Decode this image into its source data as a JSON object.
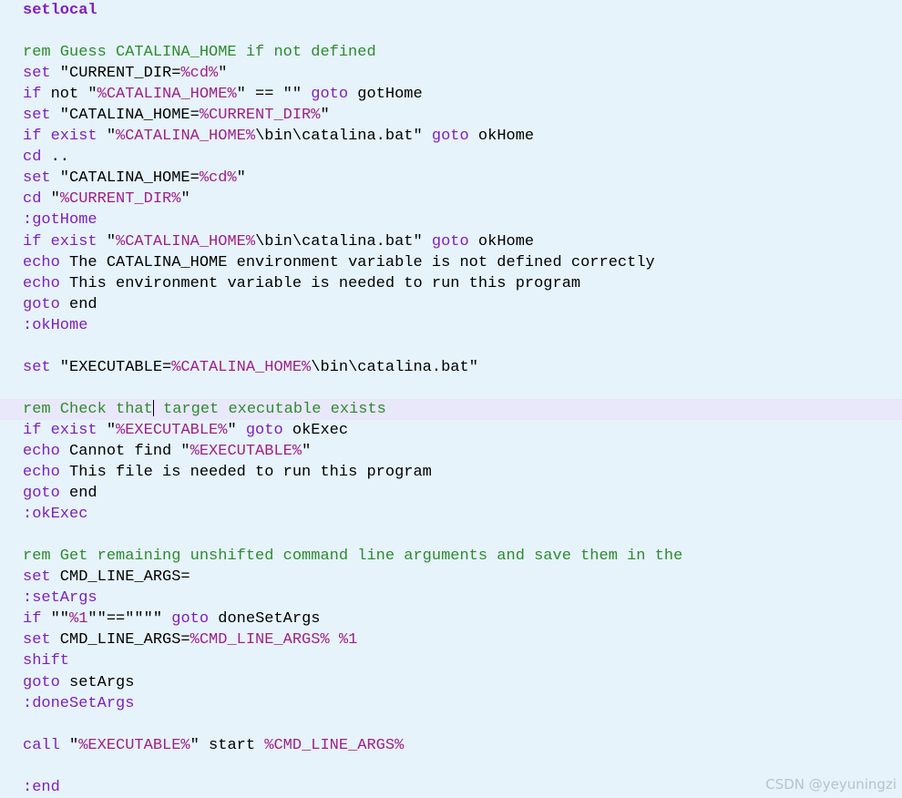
{
  "watermark": "CSDN @yeyuningzi",
  "cursor_line": 19,
  "colors": {
    "background": "#e6f3fa",
    "current_line": "#e8e8fa",
    "keyword": "#7f1fbf",
    "comment": "#2f8a2f",
    "variable": "#a0208a",
    "text": "#000000"
  },
  "code_lines": [
    [
      {
        "t": "bold",
        "s": "setlocal"
      }
    ],
    [],
    [
      {
        "t": "cmt",
        "s": "rem Guess CATALINA_HOME if not defined"
      }
    ],
    [
      {
        "t": "kw",
        "s": "set"
      },
      {
        "t": "txt",
        "s": " \"CURRENT_DIR="
      },
      {
        "t": "var",
        "s": "%cd%"
      },
      {
        "t": "txt",
        "s": "\""
      }
    ],
    [
      {
        "t": "kw",
        "s": "if"
      },
      {
        "t": "txt",
        "s": " not \""
      },
      {
        "t": "var",
        "s": "%CATALINA_HOME%"
      },
      {
        "t": "txt",
        "s": "\" == \"\" "
      },
      {
        "t": "kw",
        "s": "goto"
      },
      {
        "t": "txt",
        "s": " gotHome"
      }
    ],
    [
      {
        "t": "kw",
        "s": "set"
      },
      {
        "t": "txt",
        "s": " \"CATALINA_HOME="
      },
      {
        "t": "var",
        "s": "%CURRENT_DIR%"
      },
      {
        "t": "txt",
        "s": "\""
      }
    ],
    [
      {
        "t": "kw",
        "s": "if"
      },
      {
        "t": "txt",
        "s": " "
      },
      {
        "t": "kw",
        "s": "exist"
      },
      {
        "t": "txt",
        "s": " \""
      },
      {
        "t": "var",
        "s": "%CATALINA_HOME%"
      },
      {
        "t": "txt",
        "s": "\\bin\\catalina.bat\" "
      },
      {
        "t": "kw",
        "s": "goto"
      },
      {
        "t": "txt",
        "s": " okHome"
      }
    ],
    [
      {
        "t": "kw",
        "s": "cd"
      },
      {
        "t": "txt",
        "s": " .."
      }
    ],
    [
      {
        "t": "kw",
        "s": "set"
      },
      {
        "t": "txt",
        "s": " \"CATALINA_HOME="
      },
      {
        "t": "var",
        "s": "%cd%"
      },
      {
        "t": "txt",
        "s": "\""
      }
    ],
    [
      {
        "t": "kw",
        "s": "cd"
      },
      {
        "t": "txt",
        "s": " \""
      },
      {
        "t": "var",
        "s": "%CURRENT_DIR%"
      },
      {
        "t": "txt",
        "s": "\""
      }
    ],
    [
      {
        "t": "lbl",
        "s": ":gotHome"
      }
    ],
    [
      {
        "t": "kw",
        "s": "if"
      },
      {
        "t": "txt",
        "s": " "
      },
      {
        "t": "kw",
        "s": "exist"
      },
      {
        "t": "txt",
        "s": " \""
      },
      {
        "t": "var",
        "s": "%CATALINA_HOME%"
      },
      {
        "t": "txt",
        "s": "\\bin\\catalina.bat\" "
      },
      {
        "t": "kw",
        "s": "goto"
      },
      {
        "t": "txt",
        "s": " okHome"
      }
    ],
    [
      {
        "t": "kw",
        "s": "echo"
      },
      {
        "t": "txt",
        "s": " The CATALINA_HOME environment variable is not defined correctly"
      }
    ],
    [
      {
        "t": "kw",
        "s": "echo"
      },
      {
        "t": "txt",
        "s": " This environment variable is needed to run this program"
      }
    ],
    [
      {
        "t": "kw",
        "s": "goto"
      },
      {
        "t": "txt",
        "s": " end"
      }
    ],
    [
      {
        "t": "lbl",
        "s": ":okHome"
      }
    ],
    [],
    [
      {
        "t": "kw",
        "s": "set"
      },
      {
        "t": "txt",
        "s": " \"EXECUTABLE="
      },
      {
        "t": "var",
        "s": "%CATALINA_HOME%"
      },
      {
        "t": "txt",
        "s": "\\bin\\catalina.bat\""
      }
    ],
    [],
    [
      {
        "t": "cmt",
        "s": "rem Check that"
      },
      {
        "t": "caret",
        "s": ""
      },
      {
        "t": "cmt",
        "s": " target executable exists"
      }
    ],
    [
      {
        "t": "kw",
        "s": "if"
      },
      {
        "t": "txt",
        "s": " "
      },
      {
        "t": "kw",
        "s": "exist"
      },
      {
        "t": "txt",
        "s": " \""
      },
      {
        "t": "var",
        "s": "%EXECUTABLE%"
      },
      {
        "t": "txt",
        "s": "\" "
      },
      {
        "t": "kw",
        "s": "goto"
      },
      {
        "t": "txt",
        "s": " okExec"
      }
    ],
    [
      {
        "t": "kw",
        "s": "echo"
      },
      {
        "t": "txt",
        "s": " Cannot find \""
      },
      {
        "t": "var",
        "s": "%EXECUTABLE%"
      },
      {
        "t": "txt",
        "s": "\""
      }
    ],
    [
      {
        "t": "kw",
        "s": "echo"
      },
      {
        "t": "txt",
        "s": " This file is needed to run this program"
      }
    ],
    [
      {
        "t": "kw",
        "s": "goto"
      },
      {
        "t": "txt",
        "s": " end"
      }
    ],
    [
      {
        "t": "lbl",
        "s": ":okExec"
      }
    ],
    [],
    [
      {
        "t": "cmt",
        "s": "rem Get remaining unshifted command line arguments and save them in the"
      }
    ],
    [
      {
        "t": "kw",
        "s": "set"
      },
      {
        "t": "txt",
        "s": " CMD_LINE_ARGS="
      }
    ],
    [
      {
        "t": "lbl",
        "s": ":setArgs"
      }
    ],
    [
      {
        "t": "kw",
        "s": "if"
      },
      {
        "t": "txt",
        "s": " \"\""
      },
      {
        "t": "var",
        "s": "%1"
      },
      {
        "t": "txt",
        "s": "\"\"==\"\"\"\" "
      },
      {
        "t": "kw",
        "s": "goto"
      },
      {
        "t": "txt",
        "s": " doneSetArgs"
      }
    ],
    [
      {
        "t": "kw",
        "s": "set"
      },
      {
        "t": "txt",
        "s": " CMD_LINE_ARGS="
      },
      {
        "t": "var",
        "s": "%CMD_LINE_ARGS% %1"
      }
    ],
    [
      {
        "t": "kw",
        "s": "shift"
      }
    ],
    [
      {
        "t": "kw",
        "s": "goto"
      },
      {
        "t": "txt",
        "s": " setArgs"
      }
    ],
    [
      {
        "t": "lbl",
        "s": ":doneSetArgs"
      }
    ],
    [],
    [
      {
        "t": "kw",
        "s": "call"
      },
      {
        "t": "txt",
        "s": " \""
      },
      {
        "t": "var",
        "s": "%EXECUTABLE%"
      },
      {
        "t": "txt",
        "s": "\" start "
      },
      {
        "t": "var",
        "s": "%CMD_LINE_ARGS%"
      }
    ],
    [],
    [
      {
        "t": "lbl",
        "s": ":end"
      }
    ]
  ]
}
